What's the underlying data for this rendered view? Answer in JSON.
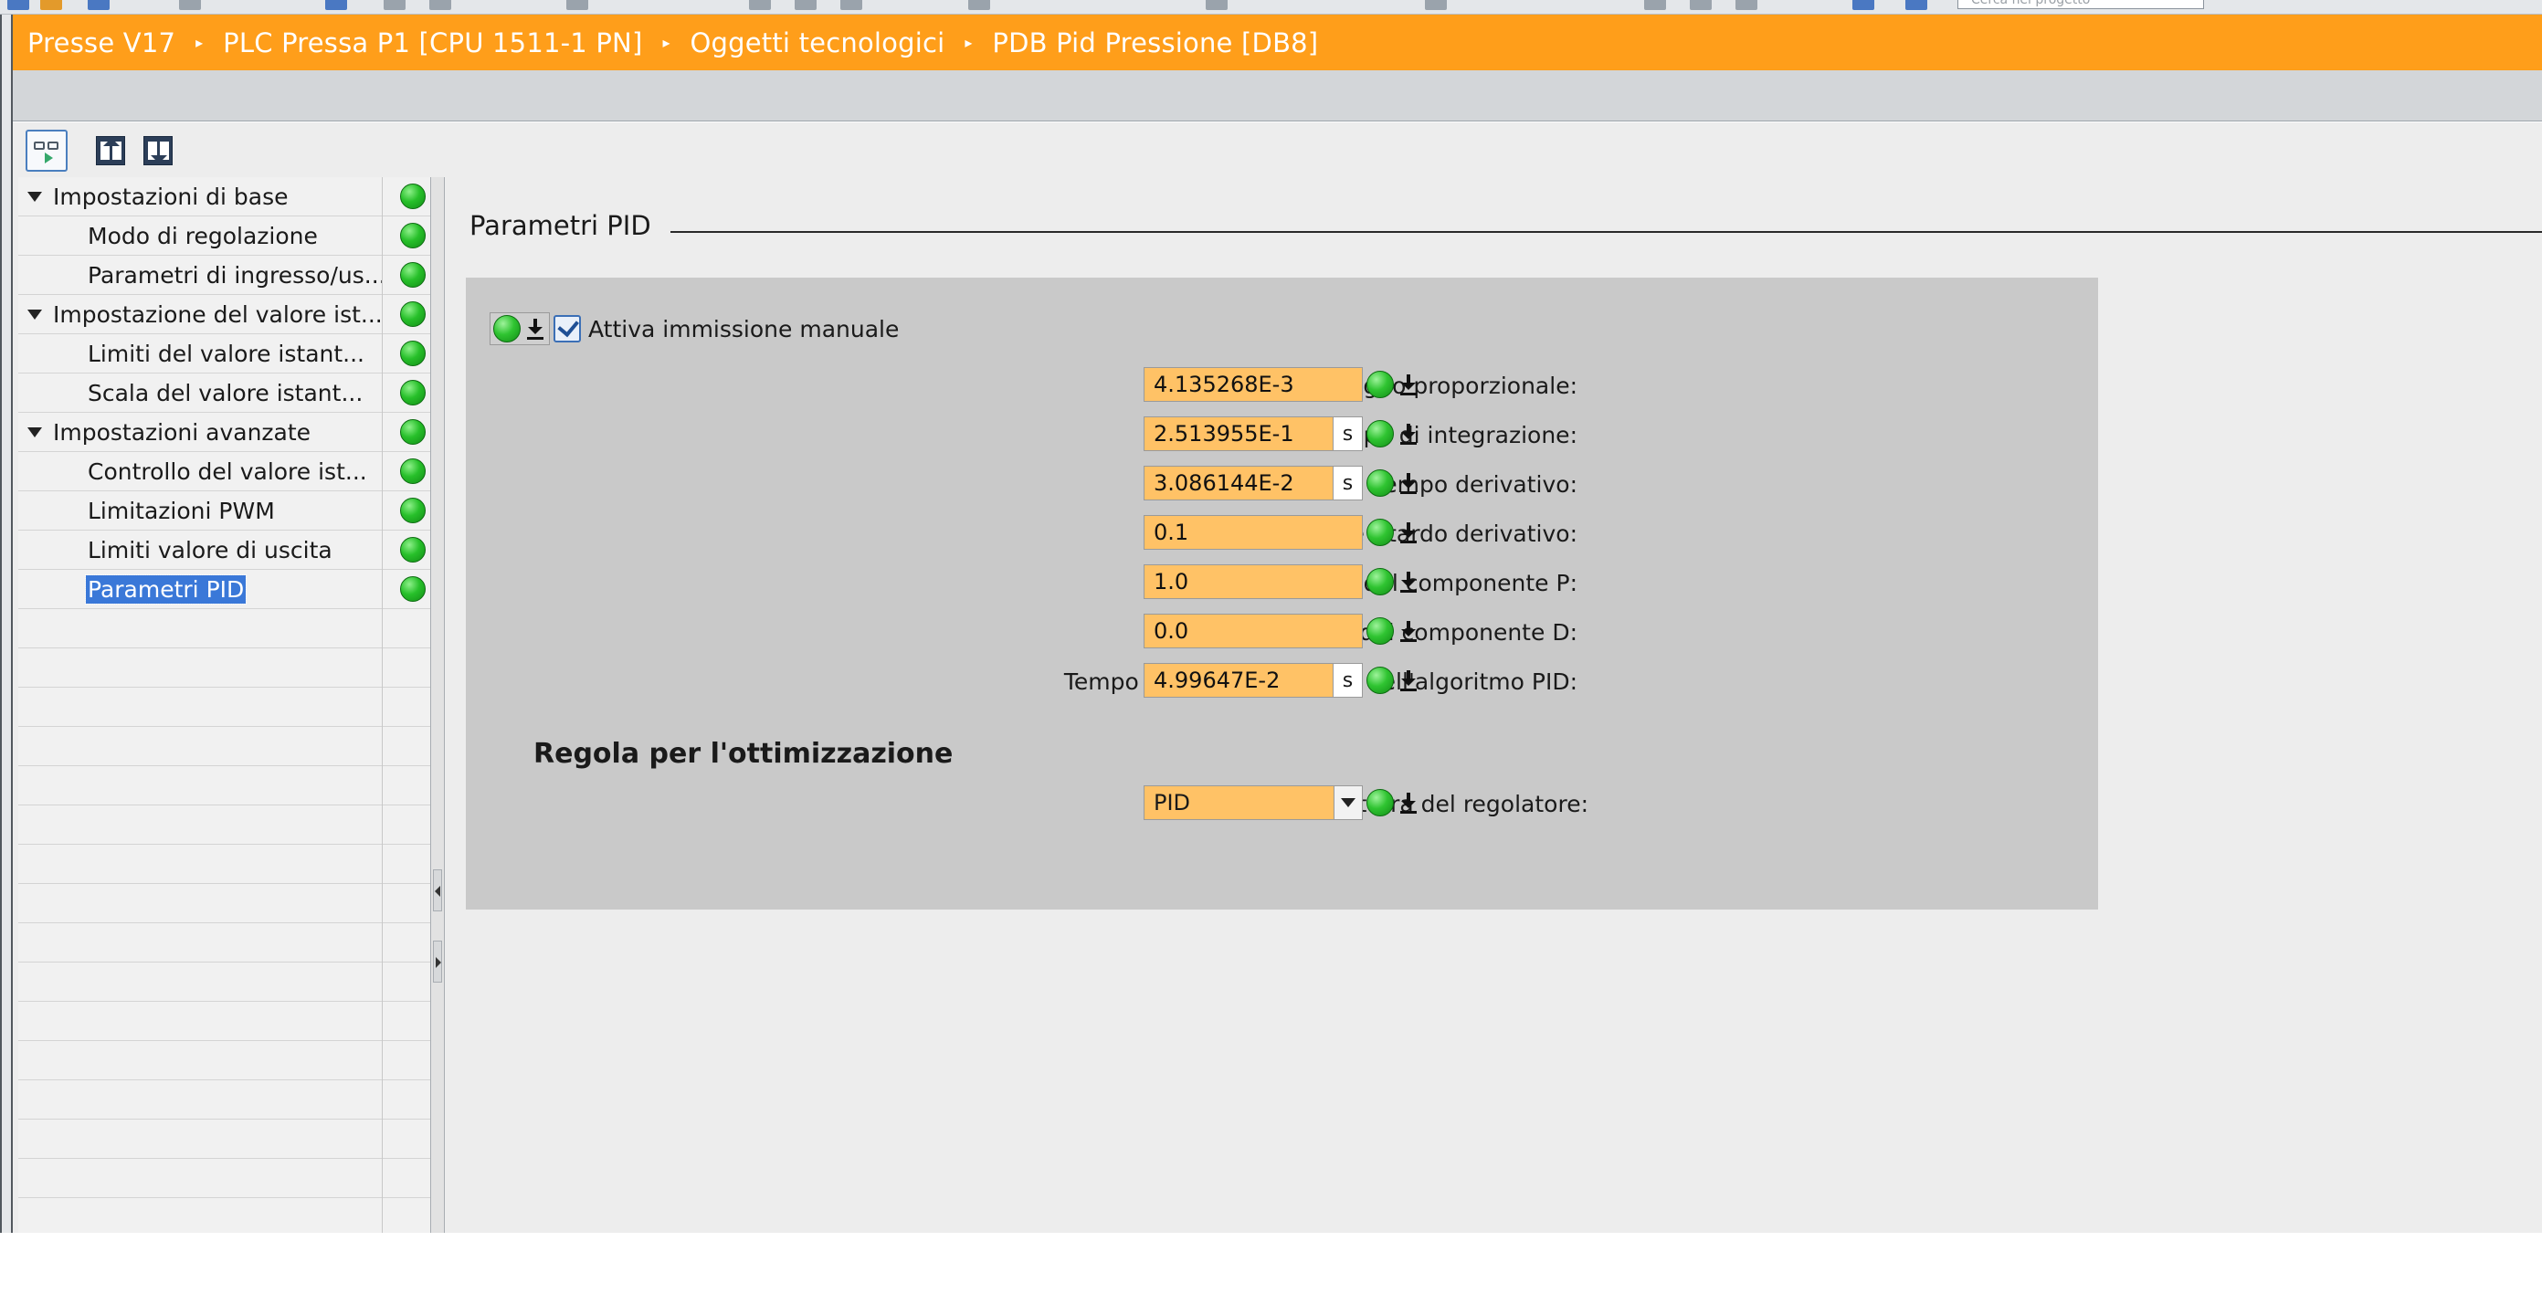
{
  "breadcrumb": {
    "items": [
      "Presse V17",
      "PLC Pressa P1 [CPU 1511-1 PN]",
      "Oggetti tecnologici",
      "PDB Pid Pressione [DB8]"
    ],
    "separator": "▸"
  },
  "toolbar_search": {
    "placeholder": "Cerca nel progetto"
  },
  "view_toolbar": {
    "buttons": [
      "functional-view-icon",
      "upload-icon",
      "download-icon"
    ]
  },
  "nav_tree": {
    "items": [
      {
        "label": "Impostazioni di base",
        "level": 0,
        "expanded": true,
        "status": "ok"
      },
      {
        "label": "Modo di regolazione",
        "level": 1,
        "status": "ok"
      },
      {
        "label": "Parametri di ingresso/us...",
        "level": 1,
        "status": "ok"
      },
      {
        "label": "Impostazione del valore ist...",
        "level": 0,
        "expanded": true,
        "status": "ok"
      },
      {
        "label": "Limiti del valore istant...",
        "level": 1,
        "status": "ok"
      },
      {
        "label": "Scala del valore istant...",
        "level": 1,
        "status": "ok"
      },
      {
        "label": "Impostazioni avanzate",
        "level": 0,
        "expanded": true,
        "status": "ok"
      },
      {
        "label": "Controllo del valore ist...",
        "level": 1,
        "status": "ok"
      },
      {
        "label": "Limitazioni PWM",
        "level": 1,
        "status": "ok"
      },
      {
        "label": "Limiti valore di uscita",
        "level": 1,
        "status": "ok"
      },
      {
        "label": "Parametri PID",
        "level": 1,
        "status": "ok",
        "selected": true
      }
    ]
  },
  "main": {
    "section_title": "Parametri PID",
    "manual_entry": {
      "label": "Attiva immissione manuale",
      "checked": true
    },
    "params": [
      {
        "label": "Guadagno proporzionale:",
        "value": "4.135268E-3",
        "unit": ""
      },
      {
        "label": "Tempo di integrazione:",
        "value": "2.513955E-1",
        "unit": "s"
      },
      {
        "label": "Tempo derivativo:",
        "value": "3.086144E-2",
        "unit": "s"
      },
      {
        "label": "Coefficiente ritardo derivativo:",
        "value": "0.1",
        "unit": ""
      },
      {
        "label": "Ponderazione del componente P:",
        "value": "1.0",
        "unit": ""
      },
      {
        "label": "Ponderazione del componente D:",
        "value": "0.0",
        "unit": ""
      },
      {
        "label": "Tempo di campionamento dell'algoritmo PID:",
        "value": "4.99647E-2",
        "unit": "s"
      }
    ],
    "tuning_title": "Regola per l'ottimizzazione",
    "controller_structure": {
      "label": "Struttura del regolatore:",
      "value": "PID"
    }
  },
  "colors": {
    "breadcrumb_bg": "#ff9e1a",
    "field_bg": "#ffc266",
    "status_ok": "#27c02a",
    "selection": "#3a78d8"
  }
}
